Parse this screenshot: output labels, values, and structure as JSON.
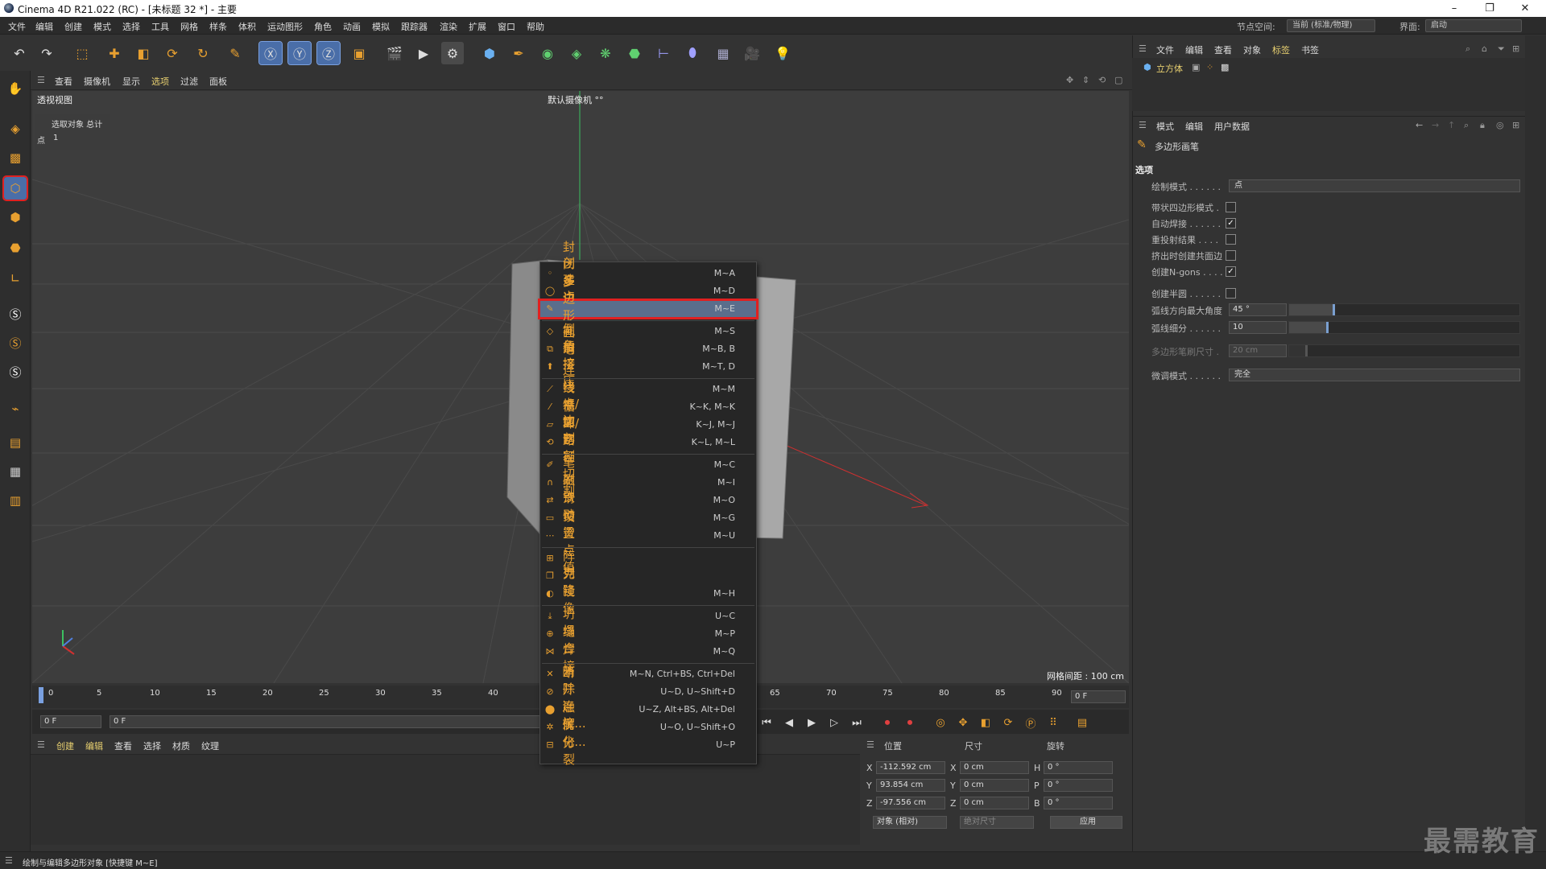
{
  "window": {
    "title": "Cinema 4D R21.022 (RC) - [未标题 32 *] - 主要",
    "min": "–",
    "max": "❐",
    "close": "✕"
  },
  "menubar": {
    "items": [
      "文件",
      "编辑",
      "创建",
      "模式",
      "选择",
      "工具",
      "网格",
      "样条",
      "体积",
      "运动图形",
      "角色",
      "动画",
      "模拟",
      "跟踪器",
      "渲染",
      "扩展",
      "窗口",
      "帮助"
    ],
    "node_space_label": "节点空间:",
    "node_space_value": "当前 (标准/物理)",
    "layout_label": "界面:",
    "layout_value": "启动"
  },
  "viewport": {
    "menu": [
      "查看",
      "摄像机",
      "显示",
      "选项",
      "过滤",
      "面板"
    ],
    "name": "透视视图",
    "camera": "默认摄像机 °°",
    "stats_header": "选取对象 总计",
    "stats_row_label": "点",
    "stats_row_value": "1",
    "grid_spacing": "网格间距 : 100 cm"
  },
  "timeline": {
    "ticks": [
      "0",
      "5",
      "10",
      "15",
      "20",
      "25",
      "30",
      "35",
      "40",
      "65",
      "70",
      "75",
      "80",
      "85",
      "90"
    ],
    "end_frame": "0 F",
    "start_frame": "0 F",
    "current_frame": "0 F"
  },
  "material": {
    "menu": [
      "创建",
      "编辑",
      "查看",
      "选择",
      "材质",
      "纹理"
    ]
  },
  "coords": {
    "headers": [
      "位置",
      "尺寸",
      "旋转"
    ],
    "rows": [
      {
        "axis": "X",
        "pos": "-112.592 cm",
        "size_axis": "X",
        "size": "0 cm",
        "rot_axis": "H",
        "rot": "0 °"
      },
      {
        "axis": "Y",
        "pos": "93.854 cm",
        "size_axis": "Y",
        "size": "0 cm",
        "rot_axis": "P",
        "rot": "0 °"
      },
      {
        "axis": "Z",
        "pos": "-97.556 cm",
        "size_axis": "Z",
        "size": "0 cm",
        "rot_axis": "B",
        "rot": "0 °"
      }
    ],
    "mode": "对象 (相对)",
    "size_mode": "绝对尺寸",
    "apply": "应用"
  },
  "objects": {
    "menu": [
      "文件",
      "编辑",
      "查看",
      "对象",
      "标签",
      "书签"
    ],
    "item": "立方体"
  },
  "attributes": {
    "menu": [
      "模式",
      "编辑",
      "用户数据"
    ],
    "tool_name": "多边形画笔",
    "section": "选项",
    "props": [
      {
        "label": "绘制模式 . . . . . .",
        "type": "dropdown",
        "value": "点"
      },
      {
        "label": "带状四边形模式 .",
        "type": "check",
        "checked": false
      },
      {
        "label": "自动焊接 . . . . . .",
        "type": "check",
        "checked": true
      },
      {
        "label": "重投射结果 . . . .",
        "type": "check",
        "checked": false
      },
      {
        "label": "挤出时创建共面边",
        "type": "check",
        "checked": false
      },
      {
        "label": "创建N-gons . . . .",
        "type": "check",
        "checked": true
      },
      {
        "label": "创建半圆 . . . . . .",
        "type": "check",
        "checked": false
      },
      {
        "label": "弧线方向最大角度",
        "type": "slider",
        "value": "45 °",
        "fraction": 0.2
      },
      {
        "label": "弧线细分 . . . . . .",
        "type": "slider",
        "value": "10",
        "fraction": 0.17
      },
      {
        "label": "多边形笔刷尺寸 .",
        "type": "slider",
        "value": "20 cm",
        "fraction": 0.08
      },
      {
        "label": "微调模式 . . . . . .",
        "type": "dropdown",
        "value": "完全"
      }
    ]
  },
  "context_menu": {
    "items": [
      {
        "label": "创建点",
        "shortcut": "M~A",
        "icon": "point-icon"
      },
      {
        "label": "封闭多边形孔洞",
        "shortcut": "M~D",
        "icon": "close-hole-icon"
      },
      {
        "label": "多边形画笔",
        "shortcut": "M~E",
        "icon": "polygon-pen-icon",
        "highlight": true
      },
      {
        "label": "倒角",
        "shortcut": "M~S",
        "icon": "bevel-icon"
      },
      {
        "label": "桥接",
        "shortcut": "M~B, B",
        "icon": "bridge-icon"
      },
      {
        "label": "挤压",
        "shortcut": "M~T, D",
        "icon": "extrude-icon"
      },
      {
        "label": "连接点/边",
        "shortcut": "M~M",
        "icon": "connect-icon"
      },
      {
        "label": "线性切割",
        "shortcut": "K~K, M~K",
        "icon": "knife-icon"
      },
      {
        "label": "平面切割",
        "shortcut": "K~J, M~J",
        "icon": "plane-cut-icon"
      },
      {
        "label": "循环/路径切割",
        "shortcut": "K~L, M~L",
        "icon": "loop-cut-icon"
      },
      {
        "label": "笔刷",
        "shortcut": "M~C",
        "icon": "brush-icon"
      },
      {
        "label": "磁铁",
        "shortcut": "M~I",
        "icon": "magnet-icon"
      },
      {
        "label": "滑动",
        "shortcut": "M~O",
        "icon": "slide-icon"
      },
      {
        "label": "熨烫",
        "shortcut": "M~G",
        "icon": "iron-icon"
      },
      {
        "label": "设置点值",
        "shortcut": "M~U",
        "icon": "set-value-icon"
      },
      {
        "label": "阵列",
        "shortcut": "",
        "icon": "array-icon"
      },
      {
        "label": "克隆",
        "shortcut": "",
        "icon": "clone-icon"
      },
      {
        "label": "镜像",
        "shortcut": "M~H",
        "icon": "mirror-icon"
      },
      {
        "label": "坍塌",
        "shortcut": "U~C",
        "icon": "collapse-icon"
      },
      {
        "label": "缝合",
        "shortcut": "M~P",
        "icon": "stitch-icon"
      },
      {
        "label": "焊接",
        "shortcut": "M~Q",
        "icon": "weld-icon"
      },
      {
        "label": "消除",
        "shortcut": "M~N, Ctrl+BS, Ctrl+Del",
        "icon": "dissolve-icon"
      },
      {
        "label": "断开连接...",
        "shortcut": "U~D, U~Shift+D",
        "icon": "disconnect-icon"
      },
      {
        "label": "融解",
        "shortcut": "U~Z, Alt+BS, Alt+Del",
        "icon": "melt-icon"
      },
      {
        "label": "优化...",
        "shortcut": "U~O, U~Shift+O",
        "icon": "optimize-icon"
      },
      {
        "label": "分裂",
        "shortcut": "U~P",
        "icon": "split-icon"
      }
    ]
  },
  "status": "绘制与编辑多边形对象 [快捷键 M~E]",
  "watermark": "最需教育",
  "colors": {
    "accent": "#4a6ea8",
    "highlight_border": "#e02020",
    "menu_hover": "#5a6e8c",
    "icon_orange": "#e8a030"
  }
}
